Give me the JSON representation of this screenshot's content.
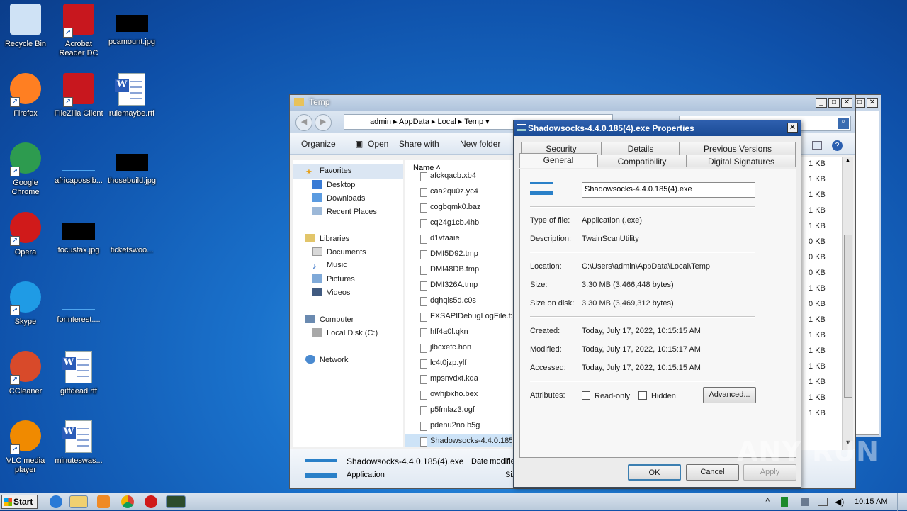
{
  "desktop": {
    "icons": [
      {
        "label": "Recycle Bin",
        "icon": "recycle-bin-icon"
      },
      {
        "label": "Acrobat Reader DC",
        "icon": "acrobat-icon"
      },
      {
        "label": "pcamount.jpg",
        "icon": "image-file-icon"
      },
      {
        "label": "Firefox",
        "icon": "firefox-icon"
      },
      {
        "label": "FileZilla Client",
        "icon": "filezilla-icon"
      },
      {
        "label": "rulemaybe.rtf",
        "icon": "word-doc-icon"
      },
      {
        "label": "Google Chrome",
        "icon": "chrome-icon"
      },
      {
        "label": "africapossib...",
        "icon": "file-icon"
      },
      {
        "label": "thosebuild.jpg",
        "icon": "image-file-icon"
      },
      {
        "label": "Opera",
        "icon": "opera-icon"
      },
      {
        "label": "focustax.jpg",
        "icon": "image-file-icon"
      },
      {
        "label": "ticketswoo...",
        "icon": "file-icon"
      },
      {
        "label": "Skype",
        "icon": "skype-icon"
      },
      {
        "label": "forinterest....",
        "icon": "file-icon"
      },
      {
        "label": "CCleaner",
        "icon": "ccleaner-icon"
      },
      {
        "label": "giftdead.rtf",
        "icon": "word-doc-icon"
      },
      {
        "label": "VLC media player",
        "icon": "vlc-icon"
      },
      {
        "label": "minuteswas...",
        "icon": "word-doc-icon"
      }
    ]
  },
  "explorer": {
    "title": "Temp",
    "breadcrumb": [
      "admin",
      "AppData",
      "Local",
      "Temp"
    ],
    "toolbar": {
      "organize": "Organize",
      "open": "Open",
      "share": "Share with",
      "new_folder": "New folder"
    },
    "nav": {
      "favorites": "Favorites",
      "desktop": "Desktop",
      "downloads": "Downloads",
      "recent": "Recent Places",
      "libraries": "Libraries",
      "documents": "Documents",
      "music": "Music",
      "pictures": "Pictures",
      "videos": "Videos",
      "computer": "Computer",
      "local_disk": "Local Disk (C:)",
      "network": "Network"
    },
    "column_name": "Name",
    "files": [
      {
        "name": "afckqacb.xb4",
        "size": "1 KB"
      },
      {
        "name": "caa2qu0z.yc4",
        "size": "1 KB"
      },
      {
        "name": "cogbqmk0.baz",
        "size": "1 KB"
      },
      {
        "name": "cq24g1cb.4hb",
        "size": "1 KB"
      },
      {
        "name": "d1vtaaie",
        "size": "1 KB"
      },
      {
        "name": "DMI5D92.tmp",
        "size": "0 KB"
      },
      {
        "name": "DMI48DB.tmp",
        "size": "0 KB"
      },
      {
        "name": "DMI326A.tmp",
        "size": "0 KB"
      },
      {
        "name": "dqhqls5d.c0s",
        "size": "1 KB"
      },
      {
        "name": "FXSAPIDebugLogFile.txt",
        "size": "0 KB"
      },
      {
        "name": "hff4a0l.qkn",
        "size": "1 KB"
      },
      {
        "name": "jlbcxefc.hon",
        "size": "1 KB"
      },
      {
        "name": "lc4t0jzp.ylf",
        "size": "1 KB"
      },
      {
        "name": "mpsnvdxt.kda",
        "size": "1 KB"
      },
      {
        "name": "owhjbxho.bex",
        "size": "1 KB"
      },
      {
        "name": "p5fmlaz3.ogf",
        "size": "1 KB"
      },
      {
        "name": "pdenu2no.b5g",
        "size": "1 KB"
      },
      {
        "name": "Shadowsocks-4.4.0.185",
        "size": ""
      }
    ],
    "details": {
      "name": "Shadowsocks-4.4.0.185(4).exe",
      "type": "Application",
      "date_label": "Date modifie",
      "size_label": "Siz"
    }
  },
  "properties": {
    "title": "Shadowsocks-4.4.0.185(4).exe Properties",
    "tabs_row1": [
      "Security",
      "Details",
      "Previous Versions"
    ],
    "tabs_row2": [
      "General",
      "Compatibility",
      "Digital Signatures"
    ],
    "filename": "Shadowsocks-4.4.0.185(4).exe",
    "type_label": "Type of file:",
    "type_value": "Application (.exe)",
    "desc_label": "Description:",
    "desc_value": "TwainScanUtility",
    "location_label": "Location:",
    "location_value": "C:\\Users\\admin\\AppData\\Local\\Temp",
    "size_label": "Size:",
    "size_value": "3.30 MB (3,466,448 bytes)",
    "disk_label": "Size on disk:",
    "disk_value": "3.30 MB (3,469,312 bytes)",
    "created_label": "Created:",
    "created_value": "Today, July 17, 2022, 10:15:15 AM",
    "modified_label": "Modified:",
    "modified_value": "Today, July 17, 2022, 10:15:17 AM",
    "accessed_label": "Accessed:",
    "accessed_value": "Today, July 17, 2022, 10:15:15 AM",
    "attributes_label": "Attributes:",
    "readonly": "Read-only",
    "hidden": "Hidden",
    "advanced": "Advanced...",
    "ok": "OK",
    "cancel": "Cancel",
    "apply": "Apply"
  },
  "taskbar": {
    "start": "Start",
    "clock": "10:15 AM"
  },
  "watermark": "ANY RUN"
}
